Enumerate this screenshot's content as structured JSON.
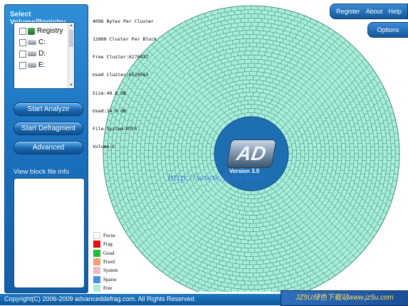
{
  "left_panel": {
    "title": "Select Volume/Registry",
    "volumes": [
      {
        "label": "Registry",
        "icon": "registry-icon",
        "checked": false
      },
      {
        "label": "C:",
        "icon": "drive-icon",
        "checked": false
      },
      {
        "label": "D:",
        "icon": "drive-icon",
        "checked": false
      },
      {
        "label": "E:",
        "icon": "drive-icon",
        "checked": false
      }
    ],
    "buttons": {
      "analyze": "Start Analyze",
      "defragment": "Start Defragment",
      "advanced": "Advanced"
    },
    "info_title": "View block file info"
  },
  "stats": [
    "4096 Bytes Per Cluster",
    "12800 Cluster Per Block",
    "Free Cluster:6270437",
    "Used Cluster:6529563",
    "Size:48.8 GB",
    "Used:24.9 GB",
    "File System:NTFS",
    "Volume:C"
  ],
  "logo": {
    "text": "AD",
    "version": "Version 3.0"
  },
  "watermark": "http://www.jz5u.com",
  "legend": [
    {
      "label": "Focus",
      "color": "#ffffff"
    },
    {
      "label": "Frag",
      "color": "#e01010"
    },
    {
      "label": "Good",
      "color": "#1fbf3a"
    },
    {
      "label": "Fixed",
      "color": "#f2a070"
    },
    {
      "label": "System",
      "color": "#f5b6c8"
    },
    {
      "label": "Sparse",
      "color": "#4a8fe6"
    },
    {
      "label": "Free",
      "color": "#a8ecda"
    }
  ],
  "map_colors": {
    "free": "#a8ecda",
    "line": "#2d7f6c",
    "center": "#1d6fb2"
  },
  "topnav": {
    "register": "Register",
    "about": "About",
    "help": "Help",
    "options": "Options"
  },
  "footer": {
    "copyright": "Copyright(C) 2006-2009 advanceddefrag.com. All Rights Reserved.",
    "badge": "JZ5U绿色下载站www.jz5u.com"
  }
}
